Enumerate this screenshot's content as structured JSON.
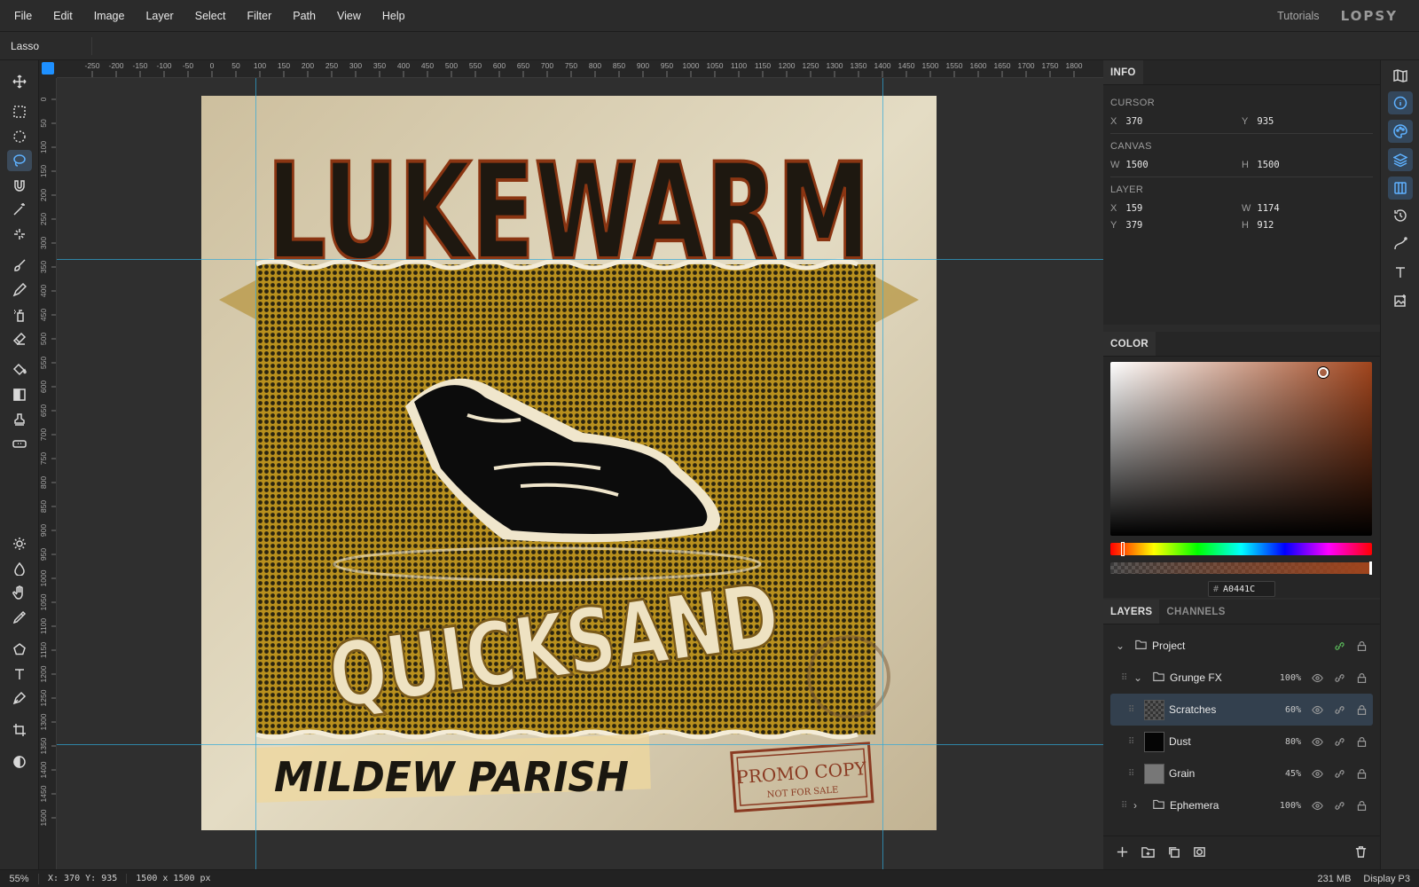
{
  "menubar": {
    "items": [
      "File",
      "Edit",
      "Image",
      "Layer",
      "Select",
      "Filter",
      "Path",
      "View",
      "Help"
    ],
    "tutorials": "Tutorials",
    "logo": "LOPSY"
  },
  "options": {
    "tool_name": "Lasso"
  },
  "rulers": {
    "h_ticks": [
      "-250",
      "-200",
      "-150",
      "-100",
      "-50",
      "0",
      "50",
      "100",
      "150",
      "200",
      "250",
      "300",
      "350",
      "400",
      "450",
      "500",
      "550",
      "600",
      "650",
      "700",
      "750",
      "800",
      "850",
      "900",
      "950",
      "1000",
      "1050",
      "1100",
      "1150",
      "1200",
      "1250",
      "1300",
      "1350",
      "1400",
      "1450",
      "1500",
      "1550",
      "1600",
      "1650",
      "1700",
      "1750",
      "1800"
    ],
    "v_ticks": [
      "0",
      "50",
      "100",
      "150",
      "200",
      "250",
      "300",
      "350",
      "400",
      "450",
      "500",
      "550",
      "600",
      "650",
      "700",
      "750",
      "800",
      "850",
      "900",
      "950",
      "1000",
      "1050",
      "1100",
      "1150",
      "1200",
      "1250",
      "1300",
      "1350",
      "1400",
      "1450",
      "1500"
    ]
  },
  "artwork": {
    "title": "LUKEWARM",
    "subtitle": "QUICKSAND",
    "artist": "MILDEW PARISH",
    "stamp_line1": "PROMO COPY",
    "stamp_line2": "NOT FOR SALE"
  },
  "info": {
    "tab": "INFO",
    "cursor_title": "CURSOR",
    "cursor": {
      "x_label": "X",
      "x": "370",
      "y_label": "Y",
      "y": "935"
    },
    "canvas_title": "CANVAS",
    "canvas": {
      "w_label": "W",
      "w": "1500",
      "h_label": "H",
      "h": "1500"
    },
    "layer_title": "LAYER",
    "layer": {
      "x_label": "X",
      "x": "159",
      "w_label": "W",
      "w": "1174",
      "y_label": "Y",
      "y": "379",
      "h_label": "H",
      "h": "912"
    }
  },
  "color": {
    "tab": "COLOR",
    "hex_prefix": "#",
    "hex": "A0441C",
    "base_color": "#a0441c"
  },
  "layers": {
    "tab_layers": "LAYERS",
    "tab_channels": "CHANNELS",
    "rows": [
      {
        "name": "Project",
        "opacity": ""
      },
      {
        "name": "Grunge FX",
        "opacity": "100%"
      },
      {
        "name": "Scratches",
        "opacity": "60%"
      },
      {
        "name": "Dust",
        "opacity": "80%"
      },
      {
        "name": "Grain",
        "opacity": "45%"
      },
      {
        "name": "Ephemera",
        "opacity": "100%"
      }
    ]
  },
  "status": {
    "zoom": "55%",
    "coords": "X: 370 Y: 935",
    "dims": "1500 x 1500 px",
    "memory": "231 MB",
    "profile": "Display P3"
  },
  "colors": {
    "accent": "#1e90ff",
    "selection": "#33404e",
    "guide": "#2fa8d8"
  }
}
